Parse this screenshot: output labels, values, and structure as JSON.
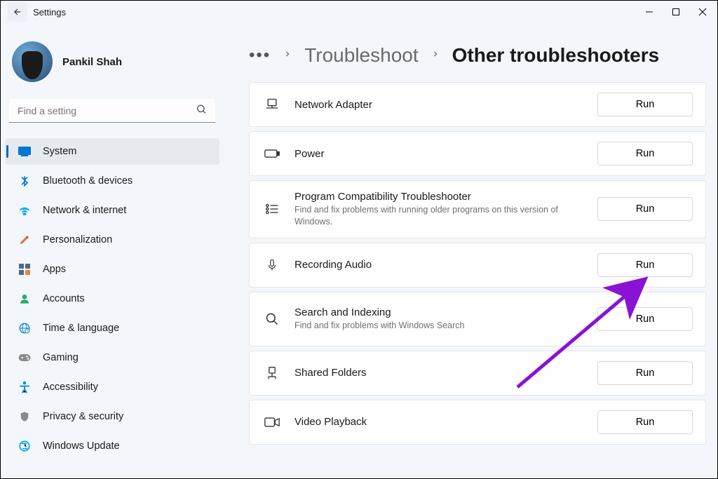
{
  "app": {
    "title": "Settings"
  },
  "profile": {
    "name": "Pankil Shah"
  },
  "search": {
    "placeholder": "Find a setting"
  },
  "sidebar": {
    "items": [
      {
        "label": "System",
        "icon": "system"
      },
      {
        "label": "Bluetooth & devices",
        "icon": "bluetooth"
      },
      {
        "label": "Network & internet",
        "icon": "wifi"
      },
      {
        "label": "Personalization",
        "icon": "brush"
      },
      {
        "label": "Apps",
        "icon": "apps"
      },
      {
        "label": "Accounts",
        "icon": "person"
      },
      {
        "label": "Time & language",
        "icon": "globe"
      },
      {
        "label": "Gaming",
        "icon": "gamepad"
      },
      {
        "label": "Accessibility",
        "icon": "accessibility"
      },
      {
        "label": "Privacy & security",
        "icon": "shield"
      },
      {
        "label": "Windows Update",
        "icon": "update"
      }
    ]
  },
  "breadcrumb": {
    "parent": "Troubleshoot",
    "current": "Other troubleshooters"
  },
  "troubleshooters": [
    {
      "title": "Network Adapter",
      "desc": "",
      "icon": "network-adapter",
      "action": "Run"
    },
    {
      "title": "Power",
      "desc": "",
      "icon": "battery",
      "action": "Run"
    },
    {
      "title": "Program Compatibility Troubleshooter",
      "desc": "Find and fix problems with running older programs on this version of Windows.",
      "icon": "compat",
      "action": "Run"
    },
    {
      "title": "Recording Audio",
      "desc": "",
      "icon": "mic",
      "action": "Run"
    },
    {
      "title": "Search and Indexing",
      "desc": "Find and fix problems with Windows Search",
      "icon": "search",
      "action": "Run"
    },
    {
      "title": "Shared Folders",
      "desc": "",
      "icon": "shared-folder",
      "action": "Run"
    },
    {
      "title": "Video Playback",
      "desc": "",
      "icon": "video",
      "action": "Run"
    }
  ]
}
